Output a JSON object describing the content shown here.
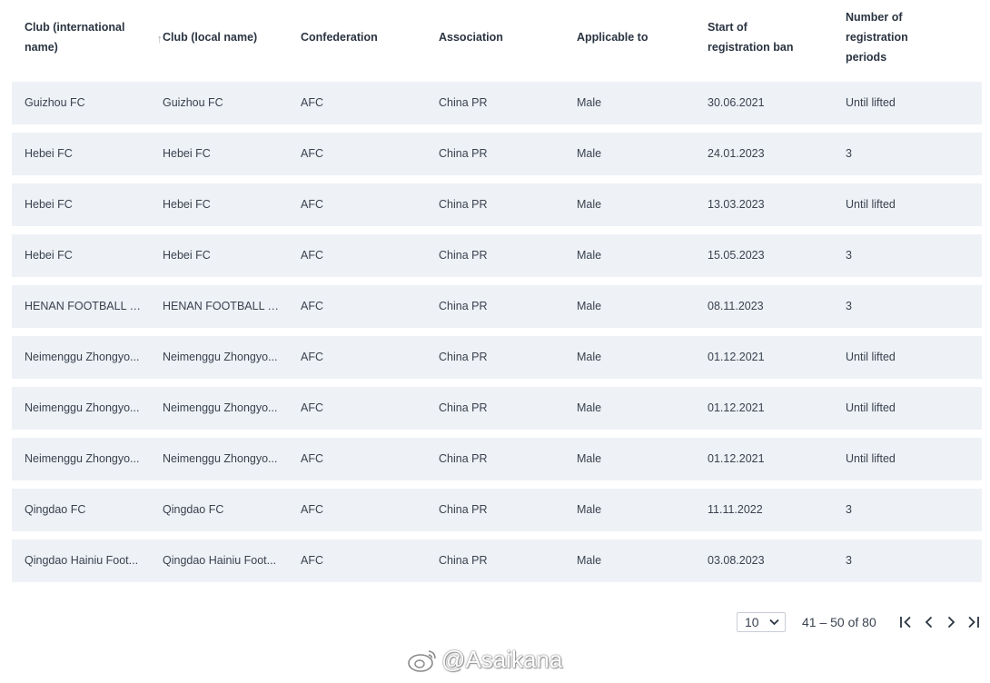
{
  "table": {
    "columns": [
      "Club (international name)",
      "Club (local name)",
      "Confederation",
      "Association",
      "Applicable to",
      "Start of registration ban",
      "Number of registration periods"
    ],
    "rows": [
      [
        "Guizhou FC",
        "Guizhou FC",
        "AFC",
        "China PR",
        "Male",
        "30.06.2021",
        "Until lifted"
      ],
      [
        "Hebei FC",
        "Hebei FC",
        "AFC",
        "China PR",
        "Male",
        "24.01.2023",
        "3"
      ],
      [
        "Hebei FC",
        "Hebei FC",
        "AFC",
        "China PR",
        "Male",
        "13.03.2023",
        "Until lifted"
      ],
      [
        "Hebei FC",
        "Hebei FC",
        "AFC",
        "China PR",
        "Male",
        "15.05.2023",
        "3"
      ],
      [
        "HENAN FOOTBALL CL...",
        "HENAN FOOTBALL CL...",
        "AFC",
        "China PR",
        "Male",
        "08.11.2023",
        "3"
      ],
      [
        "Neimenggu Zhongyo...",
        "Neimenggu Zhongyo...",
        "AFC",
        "China PR",
        "Male",
        "01.12.2021",
        "Until lifted"
      ],
      [
        "Neimenggu Zhongyo...",
        "Neimenggu Zhongyo...",
        "AFC",
        "China PR",
        "Male",
        "01.12.2021",
        "Until lifted"
      ],
      [
        "Neimenggu Zhongyo...",
        "Neimenggu Zhongyo...",
        "AFC",
        "China PR",
        "Male",
        "01.12.2021",
        "Until lifted"
      ],
      [
        "Qingdao FC",
        "Qingdao FC",
        "AFC",
        "China PR",
        "Male",
        "11.11.2022",
        "3"
      ],
      [
        "Qingdao Hainiu Foot...",
        "Qingdao Hainiu Foot...",
        "AFC",
        "China PR",
        "Male",
        "03.08.2023",
        "3"
      ]
    ]
  },
  "pagination": {
    "page_size": "10",
    "range": "41 – 50 of 80"
  },
  "watermark": "@Asaikana"
}
